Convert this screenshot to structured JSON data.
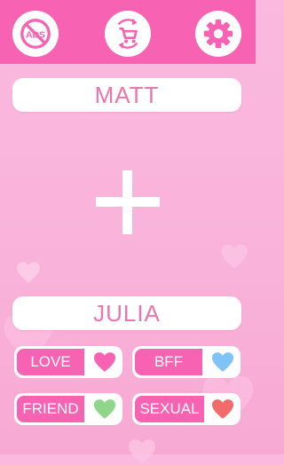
{
  "topbar": {
    "no_ads_icon_text": "ADS",
    "colors": {
      "bar": "#f762b3",
      "button": "#ffffff",
      "icon": "#f762b3"
    }
  },
  "names": {
    "first": "MATT",
    "second": "JULIA"
  },
  "modes": [
    {
      "label": "LOVE",
      "heart_color": "#f762b3"
    },
    {
      "label": "BFF",
      "heart_color": "#7ec4f7"
    },
    {
      "label": "FRIEND",
      "heart_color": "#8fd68a"
    },
    {
      "label": "SEXUAL",
      "heart_color": "#f36a6a"
    }
  ]
}
